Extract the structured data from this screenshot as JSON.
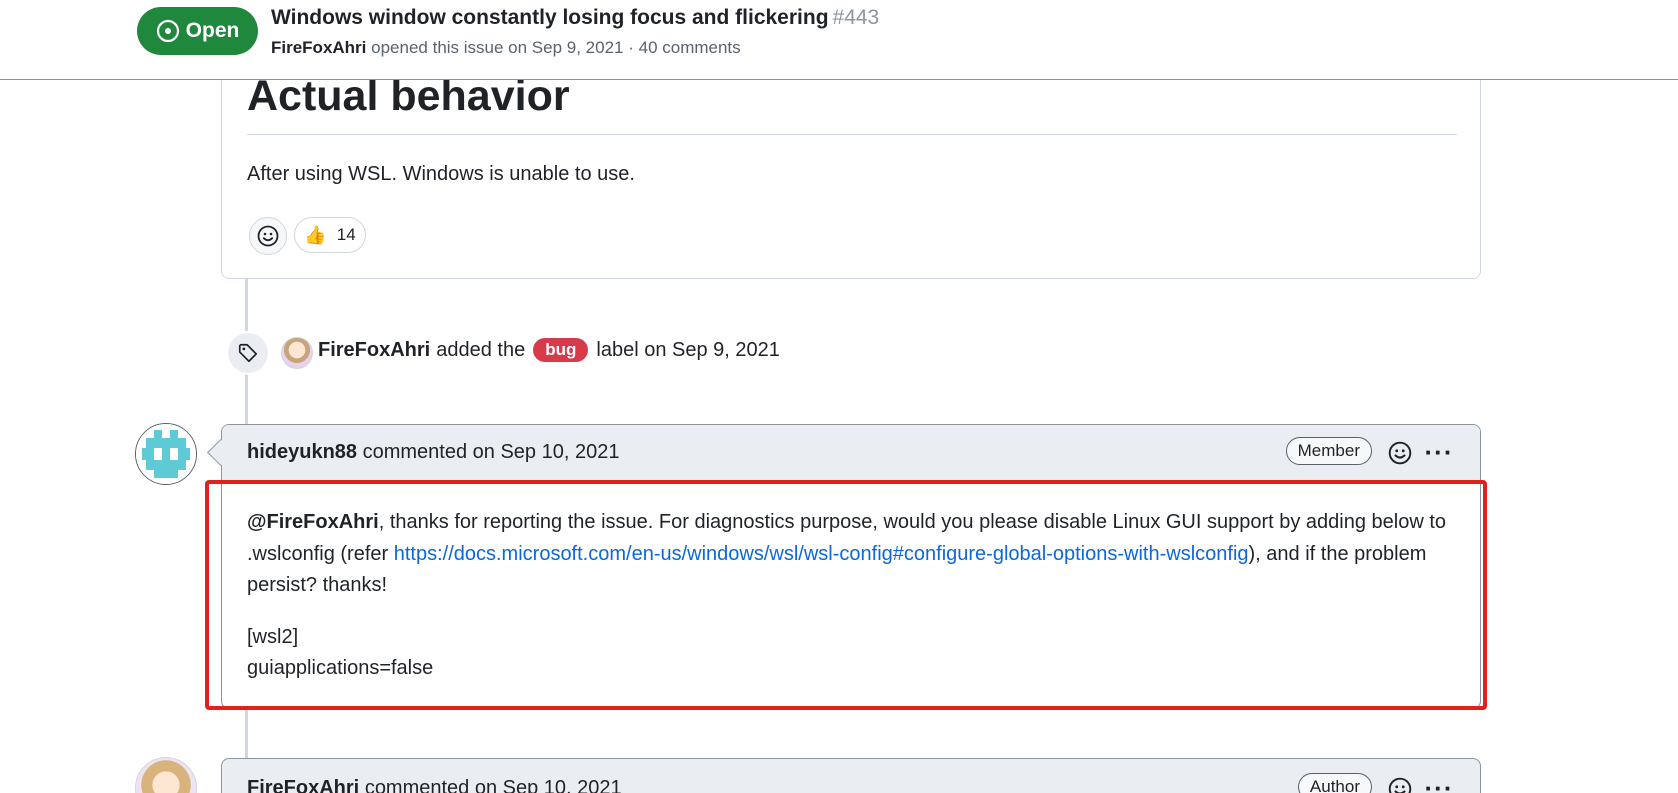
{
  "header": {
    "state": "Open",
    "title": "Windows window constantly losing focus and flickering",
    "number": "#443",
    "author": "FireFoxAhri",
    "meta_rest": "opened this issue on Sep 9, 2021 · 40 comments"
  },
  "top_comment": {
    "heading": "Actual behavior",
    "body": "After using WSL. Windows is unable to use.",
    "reactions": [
      {
        "emoji": "👍",
        "count": "14"
      }
    ]
  },
  "label_event": {
    "actor": "FireFoxAhri",
    "before": "added the",
    "label": "bug",
    "label_color": "#d73a4a",
    "after": "label on Sep 9, 2021"
  },
  "comment": {
    "author": "hideyukn88",
    "action": "commented on Sep 10, 2021",
    "role": "Member",
    "mention": "@FireFoxAhri",
    "text_1": ", thanks for reporting the issue. For diagnostics purpose, would you please disable Linux GUI support by adding below to .wslconfig (refer ",
    "link": "https://docs.microsoft.com/en-us/windows/wsl/wsl-config#configure-global-options-with-wslconfig",
    "text_2": "), and if the problem persist? thanks!",
    "config_line_1": "[wsl2]",
    "config_line_2": "guiapplications=false"
  },
  "next_comment": {
    "author": "FireFoxAhri",
    "action": "commented on Sep 10, 2021",
    "role": "Author"
  },
  "colors": {
    "open_green": "#1f883d",
    "link_blue": "#0969da",
    "highlight_red": "#e5201c"
  },
  "icons": [
    "issue-opened-icon",
    "smiley-icon",
    "thumbs-up-icon",
    "tag-icon",
    "kebab-horizontal-icon"
  ]
}
